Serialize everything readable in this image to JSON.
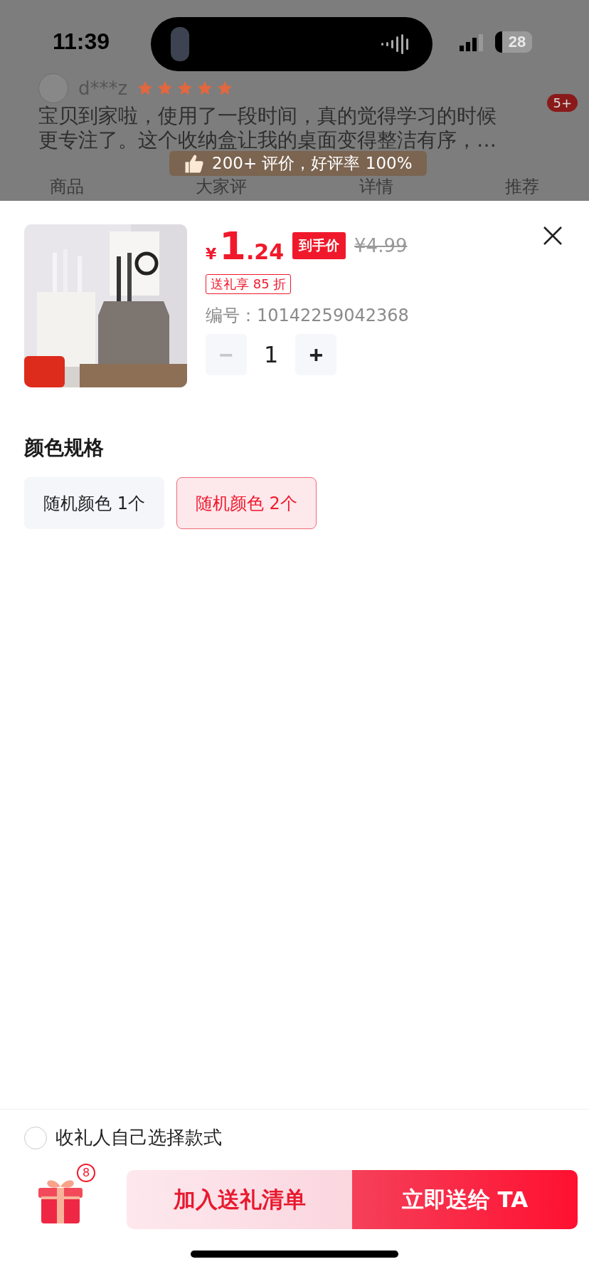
{
  "status_bar": {
    "time": "11:39",
    "battery": "28"
  },
  "background": {
    "reviewer": {
      "name": "d***z",
      "stars": 5
    },
    "review_lines": [
      "宝贝到家啦，使用了一段时间，真的觉得学习的时候",
      "更专注了。这个收纳盒让我的桌面变得整洁有序，…"
    ],
    "badge": "5+",
    "toast": "200+ 评价，好评率 100%",
    "tabs": [
      "商品",
      "大家评",
      "详情",
      "推荐"
    ]
  },
  "sheet": {
    "price": {
      "currency": "¥",
      "integer": "1",
      "decimal": ".24",
      "tag": "到手价",
      "original": "¥4.99"
    },
    "discount_tag": "送礼享 85 折",
    "sku": "编号：10142259042368",
    "quantity": {
      "value": "1",
      "minus": "−",
      "plus": "+",
      "minus_disabled": true,
      "plus_disabled": false
    },
    "section_title": "颜色规格",
    "options": [
      {
        "label": "随机颜色 1个",
        "selected": false
      },
      {
        "label": "随机颜色 2个",
        "selected": true
      }
    ],
    "recipient_choice": {
      "label": "收礼人自己选择款式",
      "checked": false
    },
    "gift_count": "8",
    "buttons": [
      {
        "label": "加入送礼清单",
        "kind": "secondary"
      },
      {
        "label": "立即送给 TA",
        "kind": "primary"
      }
    ]
  }
}
